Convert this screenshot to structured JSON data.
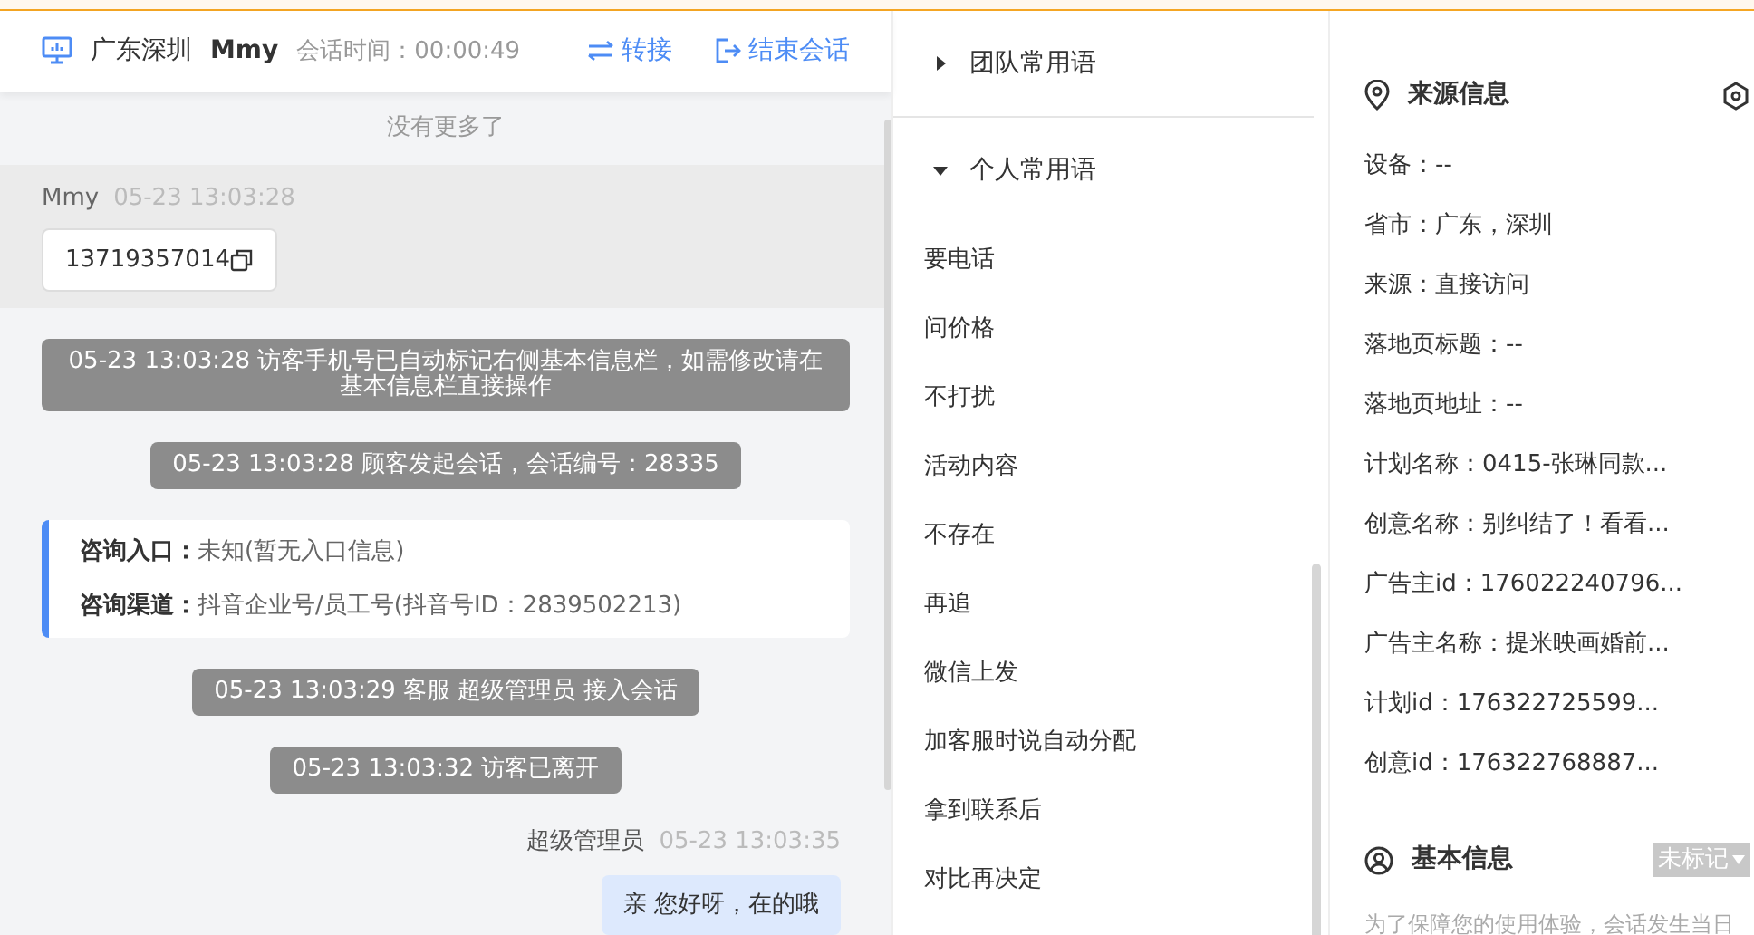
{
  "header": {
    "location": "广东深圳",
    "visitor": "Mmy",
    "duration": "会话时间：00:00:49",
    "actions": [
      "转接",
      "结束会话"
    ]
  },
  "chat": {
    "no_more": "没有更多了",
    "messages": [
      {
        "kind": "visitor",
        "name": "Mmy",
        "time": "05-23 13:03:28",
        "text": "13719357014"
      },
      {
        "kind": "system",
        "text": "05-23 13:03:28 访客手机号已自动标记右侧基本信息栏，如需修改请在基本信息栏直接操作"
      },
      {
        "kind": "system",
        "text": "05-23 13:03:28 顾客发起会话，会话编号：28335"
      },
      {
        "kind": "info",
        "rows": [
          {
            "label": "咨询入口：",
            "value": "未知(暂无入口信息)"
          },
          {
            "label": "咨询渠道：",
            "value": "抖音企业号/员工号(抖音号ID：2839502213)"
          }
        ]
      },
      {
        "kind": "system",
        "text": "05-23 13:03:29 客服 超级管理员 接入会话"
      },
      {
        "kind": "system",
        "text": "05-23 13:03:32 访客已离开"
      },
      {
        "kind": "agent",
        "name": "超级管理员",
        "time": "05-23 13:03:35",
        "text": "亲 您好呀，在的哦"
      }
    ]
  },
  "phrases": {
    "groups": [
      {
        "title": "团队常用语",
        "expanded": false
      },
      {
        "title": "个人常用语",
        "expanded": true
      }
    ],
    "items": [
      "要电话",
      "问价格",
      "不打扰",
      "活动内容",
      "不存在",
      "再追",
      "微信上发",
      "加客服时说自动分配",
      "拿到联系后",
      "对比再决定"
    ]
  },
  "source": {
    "title": "来源信息",
    "fields": [
      "设备：--",
      "省市：广东，深圳",
      "来源：直接访问",
      "落地页标题：--",
      "落地页地址：--",
      "计划名称：0415-张琳同款...",
      "创意名称：别纠结了！看看...",
      "广告主id：176022240796...",
      "广告主名称：提米映画婚前...",
      "计划id：176322725599...",
      "创意id：176322768887..."
    ]
  },
  "basic": {
    "title": "基本信息",
    "tag": "未标记",
    "note": "为了保障您的使用体验，会话发生当日"
  }
}
